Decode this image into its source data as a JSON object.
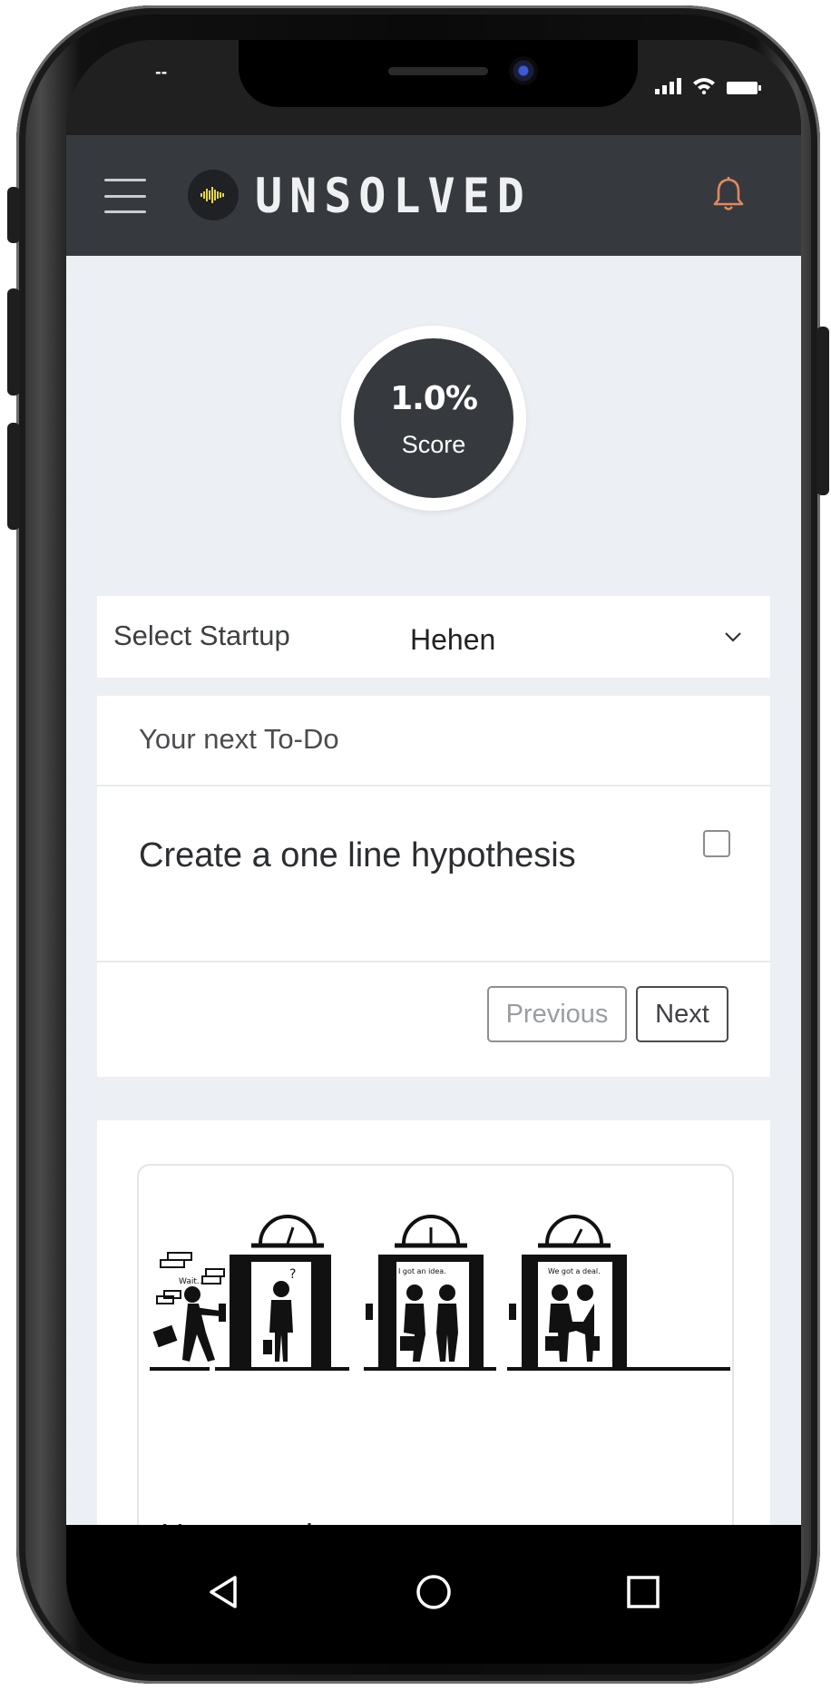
{
  "statusbar": {
    "time": "--"
  },
  "header": {
    "brand": "UNSOLVED",
    "menu_icon": "hamburger-menu-icon",
    "notification_icon": "bell-icon",
    "accent_color": "#e0895f"
  },
  "score": {
    "value": "1.0%",
    "label": "Score"
  },
  "startup_select": {
    "label": "Select Startup",
    "value": "Hehen"
  },
  "todo": {
    "heading": "Your next To-Do",
    "item": "Create a one line hypothesis",
    "checked": false,
    "previous_label": "Previous",
    "next_label": "Next"
  },
  "article": {
    "caption_1": "Wait...",
    "caption_2": "I got an idea.",
    "caption_3": "We got a deal.",
    "title": "How to write your startup one"
  },
  "navbar": {
    "back_icon": "back-triangle-icon",
    "home_icon": "home-circle-icon",
    "recents_icon": "recents-square-icon"
  }
}
